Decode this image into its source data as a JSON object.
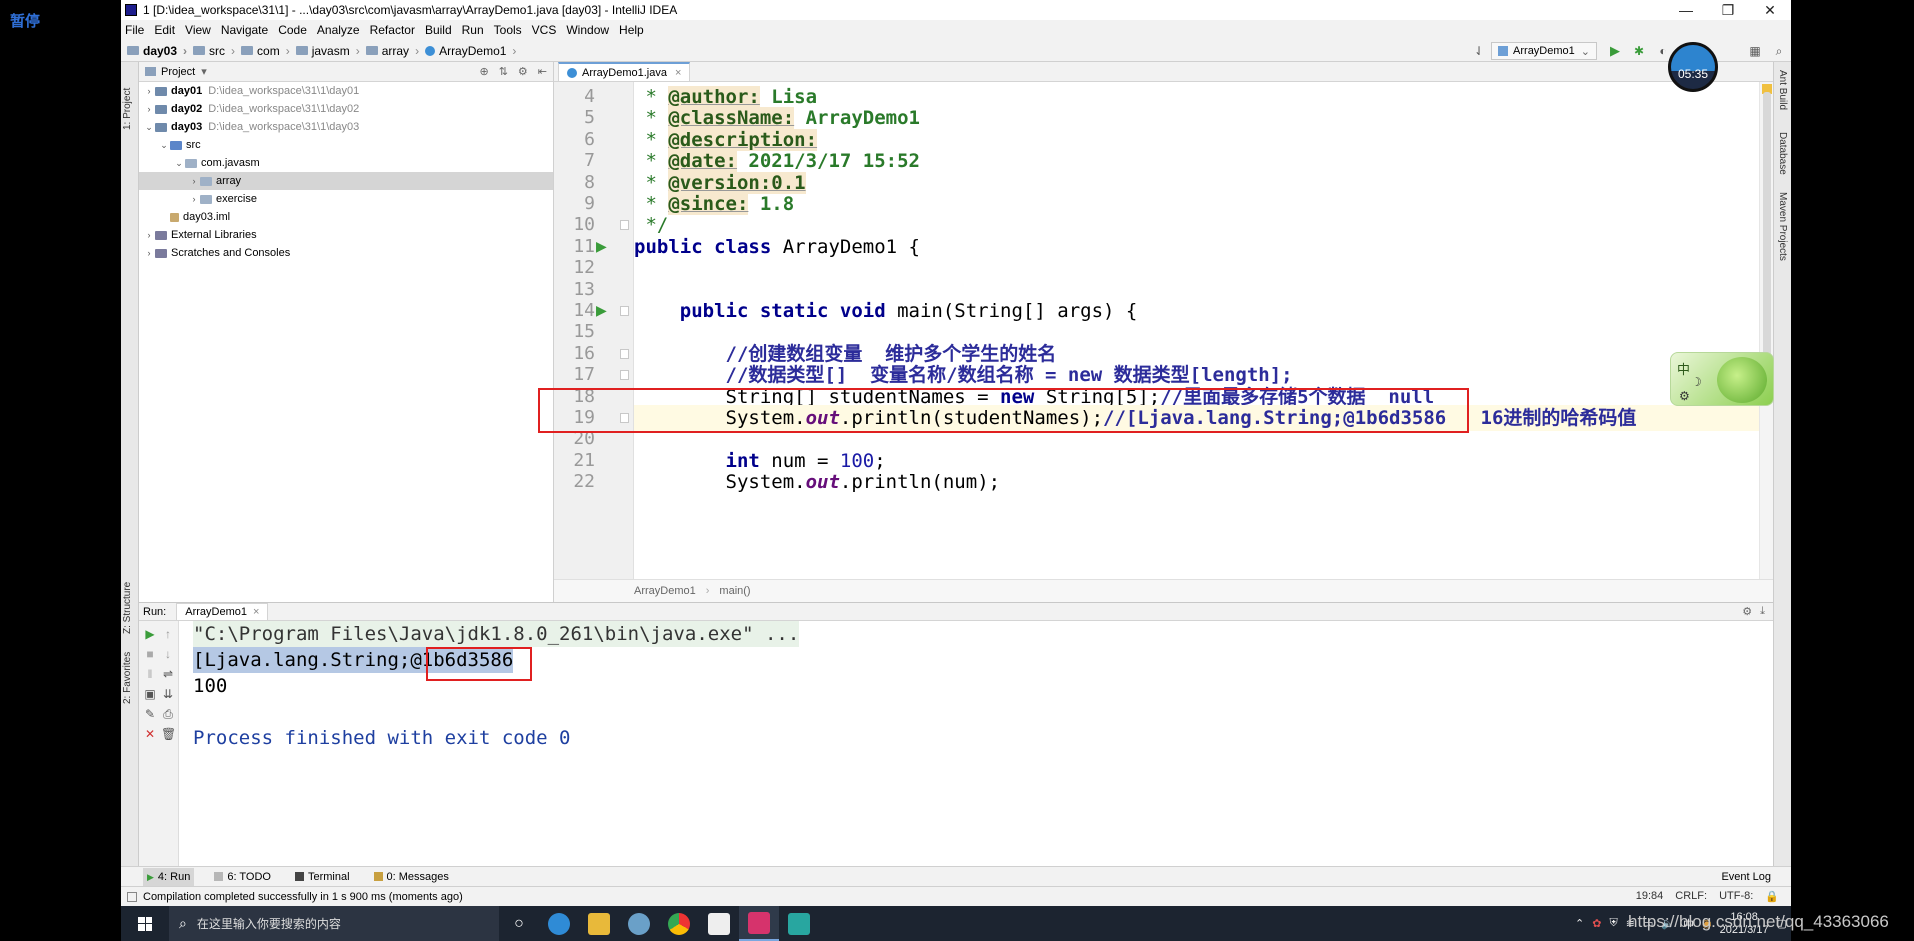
{
  "overlay": {
    "pause_label": "暂停",
    "watermark": "https://blog.csdn.net/qq_43363066",
    "timer": "05:35"
  },
  "window": {
    "title": "1 [D:\\idea_workspace\\31\\1] - ...\\day03\\src\\com\\javasm\\array\\ArrayDemo1.java [day03] - IntelliJ IDEA",
    "buttons": [
      "—",
      "❐",
      "✕"
    ]
  },
  "menu": [
    "File",
    "Edit",
    "View",
    "Navigate",
    "Code",
    "Analyze",
    "Refactor",
    "Build",
    "Run",
    "Tools",
    "VCS",
    "Window",
    "Help"
  ],
  "breadcrumb": [
    "day03",
    "src",
    "com",
    "javasm",
    "array",
    "ArrayDemo1"
  ],
  "run_config": "ArrayDemo1",
  "left_tabs": [
    "1: Project",
    "Z: Structure",
    "2: Favorites"
  ],
  "right_tabs": [
    "Ant Build",
    "Database",
    "Maven Projects"
  ],
  "project_panel": {
    "title": "Project",
    "tree": [
      {
        "name": "day01",
        "path": "D:\\idea_workspace\\31\\1\\day01",
        "bold": true,
        "arrow": "›",
        "indent": 0,
        "icon": "module"
      },
      {
        "name": "day02",
        "path": "D:\\idea_workspace\\31\\1\\day02",
        "bold": true,
        "arrow": "›",
        "indent": 0,
        "icon": "module"
      },
      {
        "name": "day03",
        "path": "D:\\idea_workspace\\31\\1\\day03",
        "bold": true,
        "arrow": "⌄",
        "indent": 0,
        "icon": "module"
      },
      {
        "name": "src",
        "path": "",
        "bold": false,
        "arrow": "⌄",
        "indent": 1,
        "icon": "src"
      },
      {
        "name": "com.javasm",
        "path": "",
        "bold": false,
        "arrow": "⌄",
        "indent": 2,
        "icon": "pkg"
      },
      {
        "name": "array",
        "path": "",
        "bold": false,
        "arrow": "›",
        "indent": 3,
        "icon": "pkg",
        "selected": true
      },
      {
        "name": "exercise",
        "path": "",
        "bold": false,
        "arrow": "›",
        "indent": 3,
        "icon": "pkg"
      },
      {
        "name": "day03.iml",
        "path": "",
        "bold": false,
        "arrow": "",
        "indent": 1,
        "icon": "file"
      },
      {
        "name": "External Libraries",
        "path": "",
        "bold": false,
        "arrow": "›",
        "indent": 0,
        "icon": "lib"
      },
      {
        "name": "Scratches and Consoles",
        "path": "",
        "bold": false,
        "arrow": "›",
        "indent": 0,
        "icon": "lib"
      }
    ]
  },
  "editor": {
    "tab": "ArrayDemo1.java",
    "crumb": [
      "ArrayDemo1",
      "main()"
    ],
    "current_line": 19
  },
  "run_panel": {
    "label": "Run:",
    "tab": "ArrayDemo1",
    "console": [
      "\"C:\\Program Files\\Java\\jdk1.8.0_261\\bin\\java.exe\" ...",
      "[Ljava.lang.String;@1b6d3586",
      "100",
      "",
      "Process finished with exit code 0"
    ]
  },
  "bottom_tabs": [
    "4: Run",
    "6: TODO",
    "Terminal",
    "0: Messages"
  ],
  "event_log": "Event Log",
  "status": {
    "message": "Compilation completed successfully in 1 s 900 ms (moments ago)",
    "position": "19:84",
    "line_sep": "CRLF:",
    "encoding": "UTF-8:"
  },
  "taskbar": {
    "search_placeholder": "在这里输入你要搜索的内容",
    "time": "16:08",
    "date": "2021/3/17",
    "tray": "中"
  },
  "ime": {
    "label": "中"
  }
}
